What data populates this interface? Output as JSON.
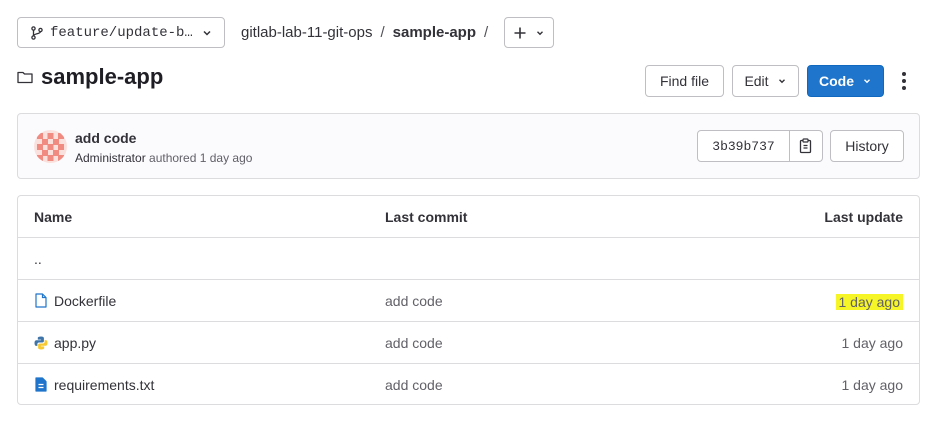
{
  "branch": {
    "name": "feature/update-b…"
  },
  "breadcrumb": {
    "group": "gitlab-lab-11-git-ops",
    "project": "sample-app",
    "sep1": "/",
    "sep2": "/"
  },
  "header": {
    "title": "sample-app",
    "find_file": "Find file",
    "edit": "Edit",
    "code": "Code"
  },
  "commit": {
    "title": "add code",
    "author": "Administrator",
    "meta": "authored 1 day ago",
    "sha": "3b39b737",
    "history": "History"
  },
  "table": {
    "headers": {
      "name": "Name",
      "last_commit": "Last commit",
      "last_update": "Last update"
    },
    "parent": "..",
    "rows": [
      {
        "name": "Dockerfile",
        "icon": "file-icon",
        "commit": "add code",
        "update": "1 day ago"
      },
      {
        "name": "app.py",
        "icon": "python-icon",
        "commit": "add code",
        "update": "1 day ago"
      },
      {
        "name": "requirements.txt",
        "icon": "text-file-icon",
        "commit": "add code",
        "update": "1 day ago"
      }
    ]
  },
  "colors": {
    "primary": "#1f75cb",
    "highlight": "#f5f527",
    "border": "#dcdcde"
  }
}
